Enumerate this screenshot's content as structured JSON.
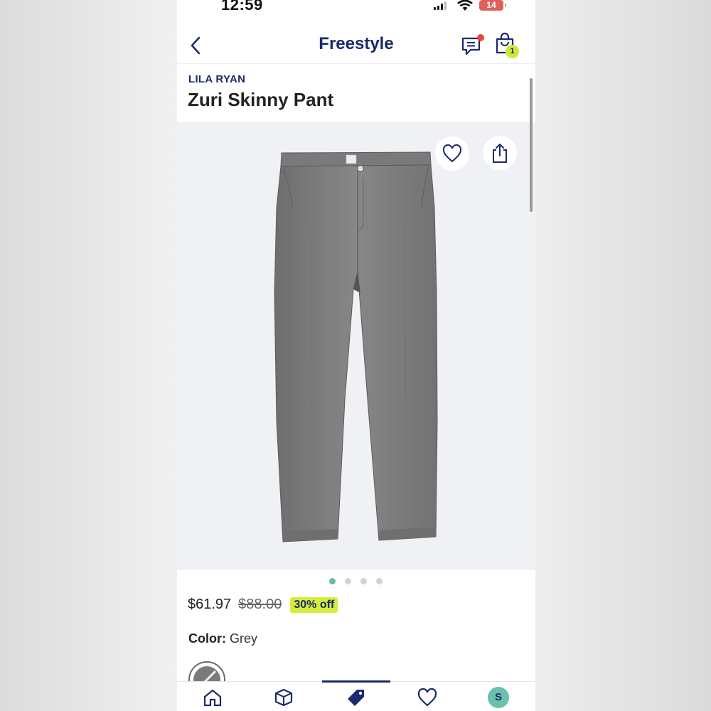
{
  "status_bar": {
    "time": "12:59",
    "battery": "14"
  },
  "header": {
    "title": "Freestyle",
    "cart_count": "1"
  },
  "product": {
    "brand": "LILA RYAN",
    "name": "Zuri Skinny Pant",
    "price": "$61.97",
    "original_price": "$88.00",
    "discount": "30% off",
    "color_label": "Color:",
    "color_value": "Grey"
  },
  "gallery": {
    "image_count": 4,
    "active_index": 1
  },
  "tabs": [
    {
      "icon": "home-icon"
    },
    {
      "icon": "box-icon"
    },
    {
      "icon": "tag-icon",
      "selected": true
    },
    {
      "icon": "heart-icon"
    },
    {
      "icon": "avatar",
      "initial": "S"
    }
  ],
  "colors": {
    "brand_navy": "#1a2a6c",
    "accent_lime": "#d6ec3b",
    "active_dot": "#6bb8a7",
    "notification": "#e8463c",
    "pants_grey": "#7b7b7b"
  }
}
